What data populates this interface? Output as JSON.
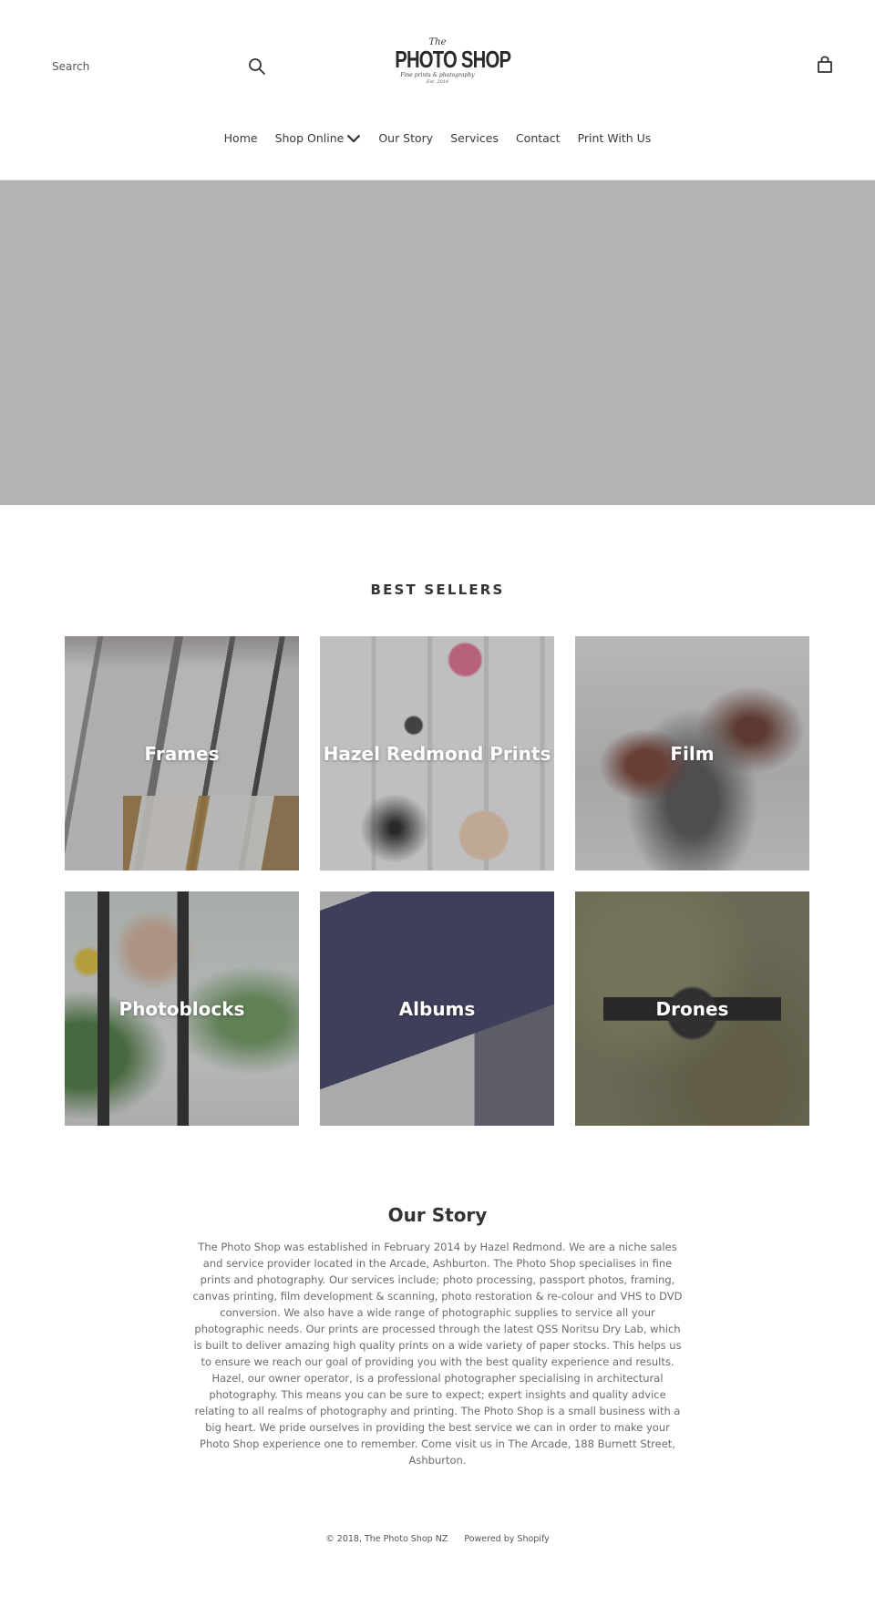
{
  "header": {
    "search": {
      "placeholder": "Search",
      "value": "",
      "icon": "search-icon"
    },
    "logo": {
      "the": "The",
      "name": "PHOTO SHOP",
      "tagline": "Fine prints & photography",
      "est": "Est. 2014"
    },
    "cart_icon": "shopping-bag-icon"
  },
  "nav": {
    "items": [
      {
        "label": "Home"
      },
      {
        "label": "Shop Online",
        "has_dropdown": true
      },
      {
        "label": "Our Story"
      },
      {
        "label": "Services"
      },
      {
        "label": "Contact"
      },
      {
        "label": "Print With Us"
      }
    ]
  },
  "hero": {
    "color": "#b2b3b5"
  },
  "best_sellers": {
    "title": "BEST SELLERS",
    "collections": [
      {
        "label": "Frames"
      },
      {
        "label": "Hazel Redmond Prints"
      },
      {
        "label": "Film"
      },
      {
        "label": "Photoblocks"
      },
      {
        "label": "Albums"
      },
      {
        "label": "Drones"
      }
    ]
  },
  "story": {
    "title": "Our Story",
    "body": "The Photo Shop was established in February 2014 by Hazel Redmond. We are a niche sales and service provider located in the Arcade, Ashburton. The Photo Shop specialises in fine prints and photography. Our services include; photo processing, passport photos, framing, canvas printing, film development & scanning, photo restoration & re-colour and VHS to DVD conversion. We also have a wide range of photographic supplies to service all your photographic needs. Our prints are processed through the latest QSS Noritsu Dry Lab, which is built to deliver amazing high quality prints on a wide variety of paper stocks. This helps us to ensure we reach our goal of providing you with the best quality experience and results. Hazel, our owner operator, is a professional photographer specialising in architectural photography. This means you can be sure to expect; expert insights and quality advice relating to all realms of photography and printing. The Photo Shop is a small business with a big heart. We pride ourselves in providing the best service we can in order to make your Photo Shop experience one to remember. Come visit us in The Arcade, 188 Burnett Street, Ashburton."
  },
  "footer": {
    "copyright": "© 2018, The Photo Shop NZ",
    "powered_by": "Powered by Shopify"
  }
}
